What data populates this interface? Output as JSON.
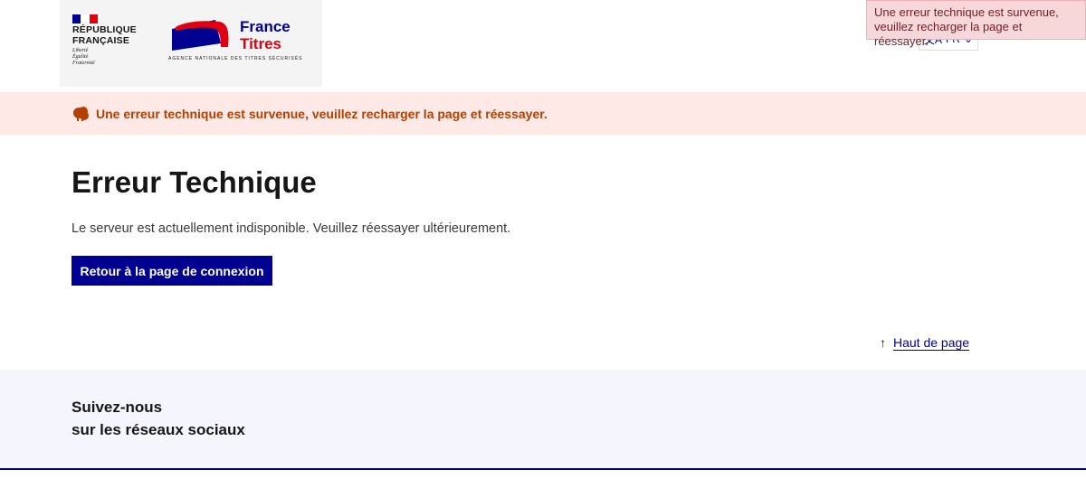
{
  "header": {
    "republique_line1": "RÉPUBLIQUE",
    "republique_line2": "FRANÇAISE",
    "devise_line1": "Liberté",
    "devise_line2": "Égalité",
    "devise_line3": "Fraternité",
    "brand_line1": "France",
    "brand_line2": "Titres",
    "brand_tagline": "AGENCE NATIONALE DES TITRES SÉCURISÉS",
    "lang_label": "FR"
  },
  "toast": {
    "message": "Une erreur technique est survenue, veuillez recharger la page et réessayer."
  },
  "alert": {
    "message": "Une erreur technique est survenue, veuillez recharger la page et réessayer."
  },
  "main": {
    "title": "Erreur Technique",
    "description": "Le serveur est actuellement indisponible. Veuillez réessayer ultérieurement.",
    "back_button": "Retour à la page de connexion",
    "top_link": "Haut de page"
  },
  "footer": {
    "title_line1": "Suivez-nous",
    "title_line2": "sur les réseaux sociaux"
  },
  "colors": {
    "primary": "#000091",
    "alert_bg": "#ffe9e6",
    "alert_text": "#b34000",
    "toast_bg": "#f8d7da",
    "toast_text": "#721c24",
    "footer_bg": "#f5f5fe",
    "brand_red": "#e1000f"
  },
  "icons": {
    "alert": "alert-icon",
    "lang": "translate-icon",
    "chevron": "chevron-down-icon",
    "arrow_up": "arrow-up-icon"
  }
}
